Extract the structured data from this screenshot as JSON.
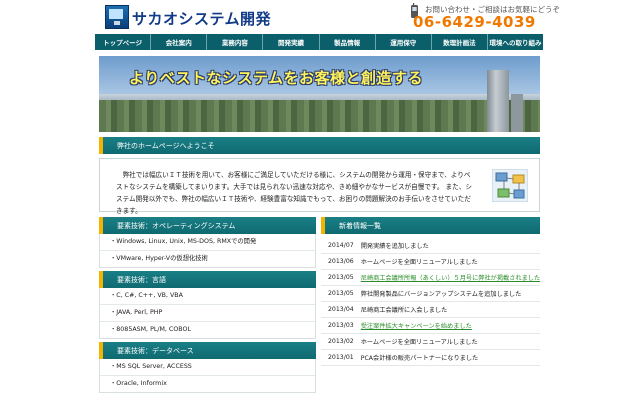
{
  "header": {
    "site_title": "サカオシステム開発",
    "contact_note": "お問い合わせ・ご相談はお気軽にどうぞ",
    "phone": "06-6429-4039"
  },
  "nav": [
    {
      "label": "トップページ"
    },
    {
      "label": "会社案内"
    },
    {
      "label": "業務内容"
    },
    {
      "label": "開発実績"
    },
    {
      "label": "製品情報"
    },
    {
      "label": "運用保守"
    },
    {
      "label": "数理計画法"
    },
    {
      "label": "環境への取り組み"
    }
  ],
  "hero": {
    "tagline": "よりベストなシステムをお客様と創造する"
  },
  "welcome": {
    "heading": "弊社のホームページへようこそ",
    "body": "弊社では幅広いＩＴ技術を用いて、お客様にご満足していただける様に、システムの開発から運用・保守まで、よりベストなシステムを構築してまいります。大手では見られない迅速な対応や、きめ細やかなサービスが自慢です。 また、システム開発以外でも、弊社の幅広いＩＴ技術や、経験豊富な知識でもって、お困りの問題解決のお手伝いをさせていただきます。"
  },
  "tech": [
    {
      "heading": "要素技術：オペレーティングシステム",
      "items": [
        "Windows, Linux, Unix, MS-DOS, RMXでの開発",
        "VMware, Hyper-Vの仮想化技術"
      ]
    },
    {
      "heading": "要素技術：言語",
      "items": [
        "C, C#, C++, VB, VBA",
        "JAVA, Perl, PHP",
        "8085ASM, PL/M, COBOL"
      ]
    },
    {
      "heading": "要素技術：データベース",
      "items": [
        "MS SQL Server, ACCESS",
        "Oracle, Informix"
      ]
    }
  ],
  "news": {
    "heading": "新着情報一覧",
    "rows": [
      {
        "date": "2014/07",
        "text": "開発実績を追加しました",
        "link": false
      },
      {
        "date": "2013/06",
        "text": "ホームページを全面リニューアルしました",
        "link": false
      },
      {
        "date": "2013/05",
        "text": "尼崎商工会議所所報（あくしい）５月号に弊社が掲載されました",
        "link": true
      },
      {
        "date": "2013/05",
        "text": "弊社開発製品にバージョンアップシステムを追加しました",
        "link": false
      },
      {
        "date": "2013/04",
        "text": "尼崎商工会議所に入会しました",
        "link": false
      },
      {
        "date": "2013/03",
        "text": "受注案件拡大キャンペーンを始めました",
        "link": true
      },
      {
        "date": "2013/02",
        "text": "ホームページを全面リニューアルしました",
        "link": false
      },
      {
        "date": "2013/01",
        "text": "PCA会計様の販売パートナーになりました",
        "link": false
      }
    ]
  }
}
